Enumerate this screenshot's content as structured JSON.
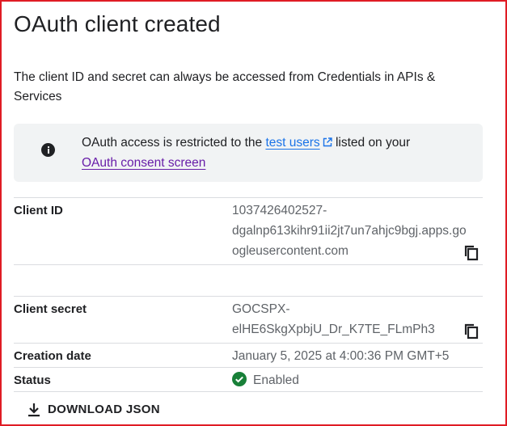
{
  "dialog": {
    "title": "OAuth client created",
    "description": "The client ID and secret can always be accessed from Credentials in APIs & Services"
  },
  "notice": {
    "text_before": "OAuth access is restricted to the ",
    "test_users_link": "test users",
    "text_after": " listed on your",
    "consent_link": "OAuth consent screen"
  },
  "details": {
    "client_id_label": "Client ID",
    "client_id_line1": "1037426402527-",
    "client_id_line2": "dgalnp613kihr91ii2jt7un7ahjc9bgj.apps.go",
    "client_id_line3": "ogleusercontent.com",
    "client_secret_label": "Client secret",
    "client_secret_line1": "GOCSPX-",
    "client_secret_line2": "elHE6SkgXpbjU_Dr_K7TE_FLmPh3",
    "creation_date_label": "Creation date",
    "creation_date_value": "January 5, 2025 at 4:00:36 PM GMT+5",
    "status_label": "Status",
    "status_value": "Enabled"
  },
  "actions": {
    "download_json": "DOWNLOAD JSON"
  },
  "colors": {
    "link_blue": "#1a73e8",
    "link_visited": "#681da8",
    "status_green": "#188038",
    "frame_border": "#e01b24"
  },
  "icons": [
    "info-icon",
    "external-link-icon",
    "copy-icon",
    "check-circle-icon",
    "download-icon"
  ]
}
